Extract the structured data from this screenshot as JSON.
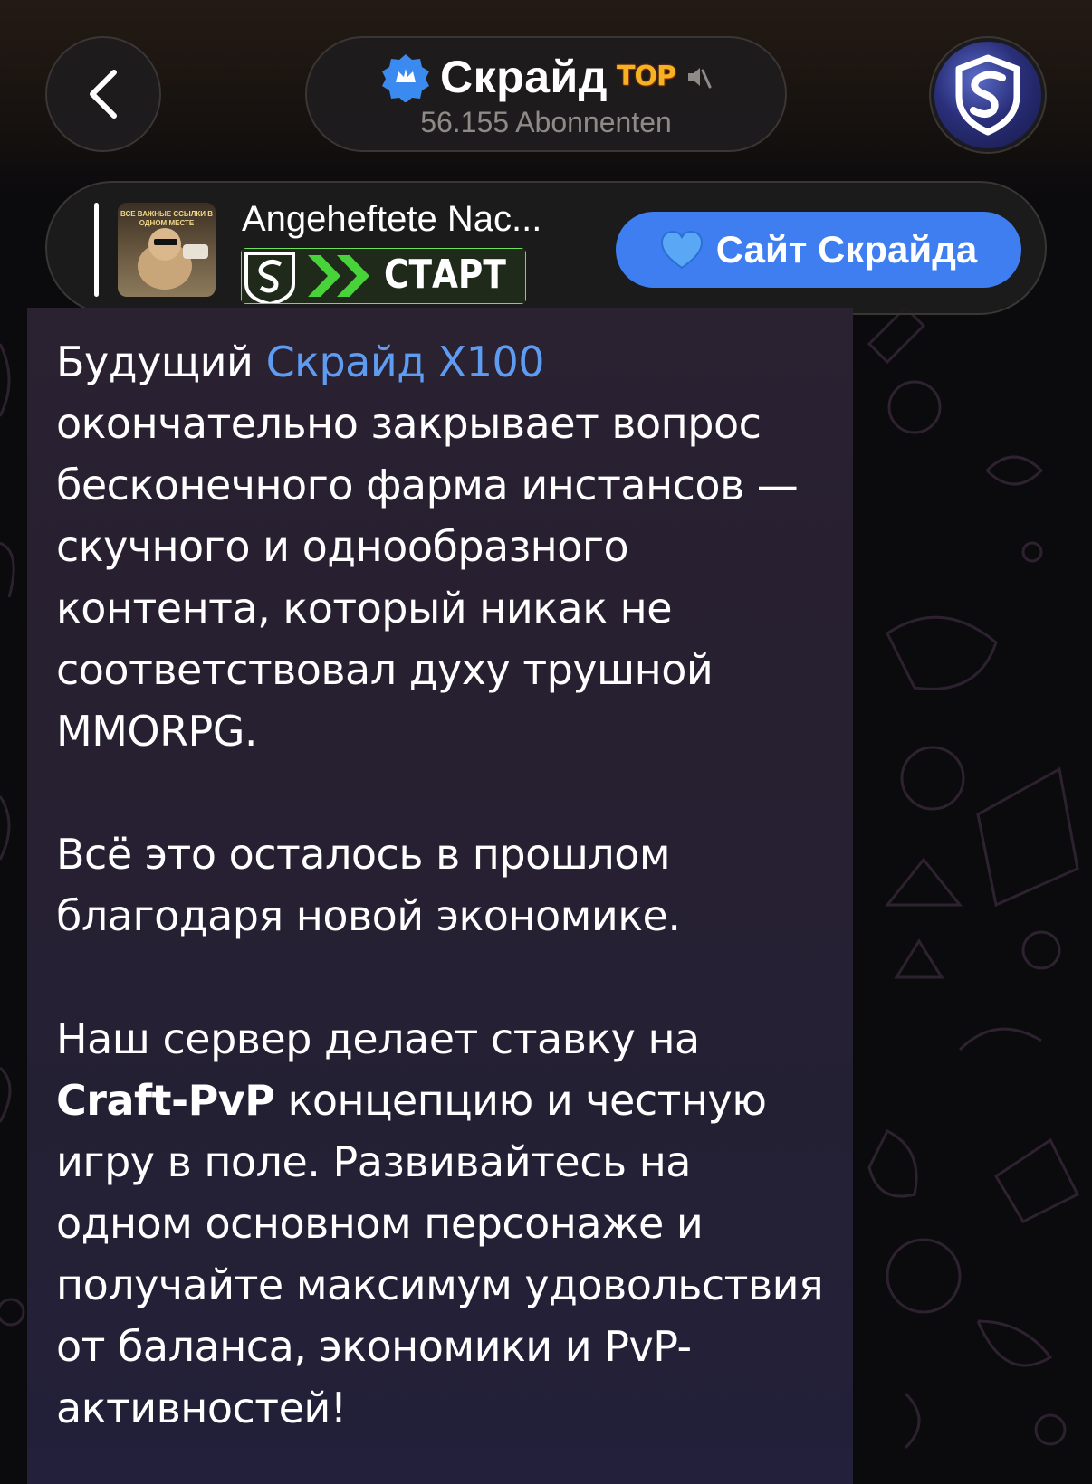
{
  "header": {
    "channel_name": "Скрайд",
    "badge": "TOP",
    "subscribers": "56.155 Abonnenten"
  },
  "pinned": {
    "title": "Angeheftete Nac...",
    "thumbnail_caption": "ВСЕ ВАЖНЫЕ ССЫЛКИ В ОДНОМ МЕСТЕ",
    "banner_label": "СТАРТ",
    "button_emoji": "💙",
    "button_label": "Сайт Скрайда"
  },
  "message": {
    "p1_lead": "Будущий ",
    "p1_link": "Скрайд X100",
    "p1_rest": "окончательно закрывает вопрос бесконечного фарма инстансов — скучного и однообразного контента, который никак не соответствовал духу трушной MMORPG.",
    "p2": "Всё это осталось в прошлом благодаря новой экономике.",
    "p3_lead": "Наш сервер делает ставку на",
    "p3_bold": "Craft-PvP",
    "p3_rest": " концепцию и честную игру в поле. Развивайтесь на одном основном персонаже и получайте максимум удовольствия от баланса, экономики и PvP-активностей!"
  },
  "colors": {
    "accent": "#3e7ef0",
    "link": "#5e9cf2",
    "verified_badge": "#3b8af0",
    "top_badge": "#f5b221"
  },
  "icons": [
    "back-chevron-icon",
    "verified-badge-icon",
    "muted-speaker-icon",
    "dragon-shield-icon",
    "blue-heart-icon"
  ]
}
